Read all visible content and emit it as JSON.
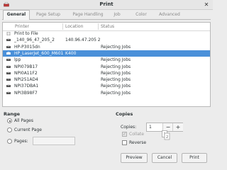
{
  "window": {
    "title": "Print"
  },
  "tabs": [
    "General",
    "Page Setup",
    "Page Handling",
    "Job",
    "Color",
    "Advanced"
  ],
  "list": {
    "headers": {
      "printer": "Printer",
      "location": "Location",
      "status": "Status"
    },
    "rows": [
      {
        "name": "Print to File",
        "location": "",
        "status": ""
      },
      {
        "name": "_140_96_47_205_2",
        "location": "140.96.47.205 2",
        "status": ""
      },
      {
        "name": "HP-P3015dn",
        "location": "",
        "status": "Rejecting Jobs"
      },
      {
        "name": "HP_LaserJet_600_M601",
        "location": "K400",
        "status": ""
      },
      {
        "name": "lpp",
        "location": "",
        "status": "Rejecting Jobs"
      },
      {
        "name": "NPI079B17",
        "location": "",
        "status": "Rejecting Jobs"
      },
      {
        "name": "NPI0A11F2",
        "location": "",
        "status": "Rejecting Jobs"
      },
      {
        "name": "NPI251AD4",
        "location": "",
        "status": "Rejecting Jobs"
      },
      {
        "name": "NPI37DBA1",
        "location": "",
        "status": "Rejecting Jobs"
      },
      {
        "name": "NPI3B98F7",
        "location": "",
        "status": "Rejecting Jobs"
      }
    ]
  },
  "range": {
    "title": "Range",
    "all_pages": "All Pages",
    "current_page": "Current Page",
    "pages": "Pages:"
  },
  "copies": {
    "title": "Copies",
    "label": "Copies:",
    "value": "1",
    "minus": "−",
    "plus": "+",
    "collate": "Collate",
    "reverse": "Reverse"
  },
  "buttons": {
    "preview": "Preview",
    "cancel": "Cancel",
    "print": "Print"
  },
  "colors": {
    "selection": "#4a90d9"
  }
}
